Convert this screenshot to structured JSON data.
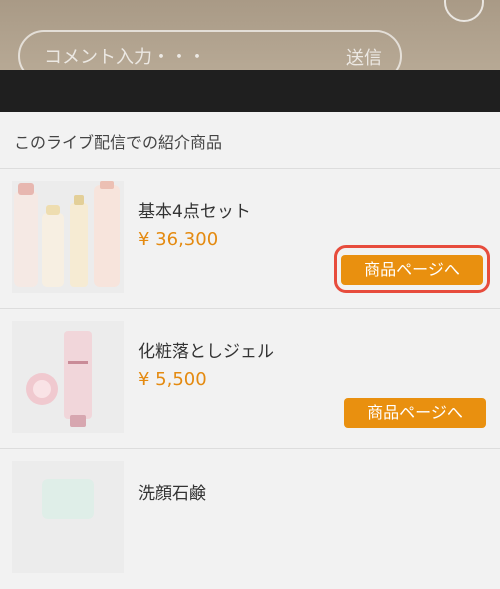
{
  "comment_bar": {
    "placeholder": "コメント入力・・・",
    "send_label": "送信"
  },
  "sheet": {
    "title": "このライブ配信での紹介商品"
  },
  "products": [
    {
      "name": "基本4点セット",
      "price": "¥ 36,300",
      "button_label": "商品ページへ",
      "highlighted": true
    },
    {
      "name": "化粧落としジェル",
      "price": "¥ 5,500",
      "button_label": "商品ページへ",
      "highlighted": false
    },
    {
      "name": "洗顔石鹸",
      "price": "",
      "button_label": "",
      "highlighted": false
    }
  ],
  "colors": {
    "accent": "#e9900f",
    "price": "#e48a10",
    "highlight_border": "#e74c3c"
  },
  "icons": {
    "top_right": "circle-button-icon"
  }
}
